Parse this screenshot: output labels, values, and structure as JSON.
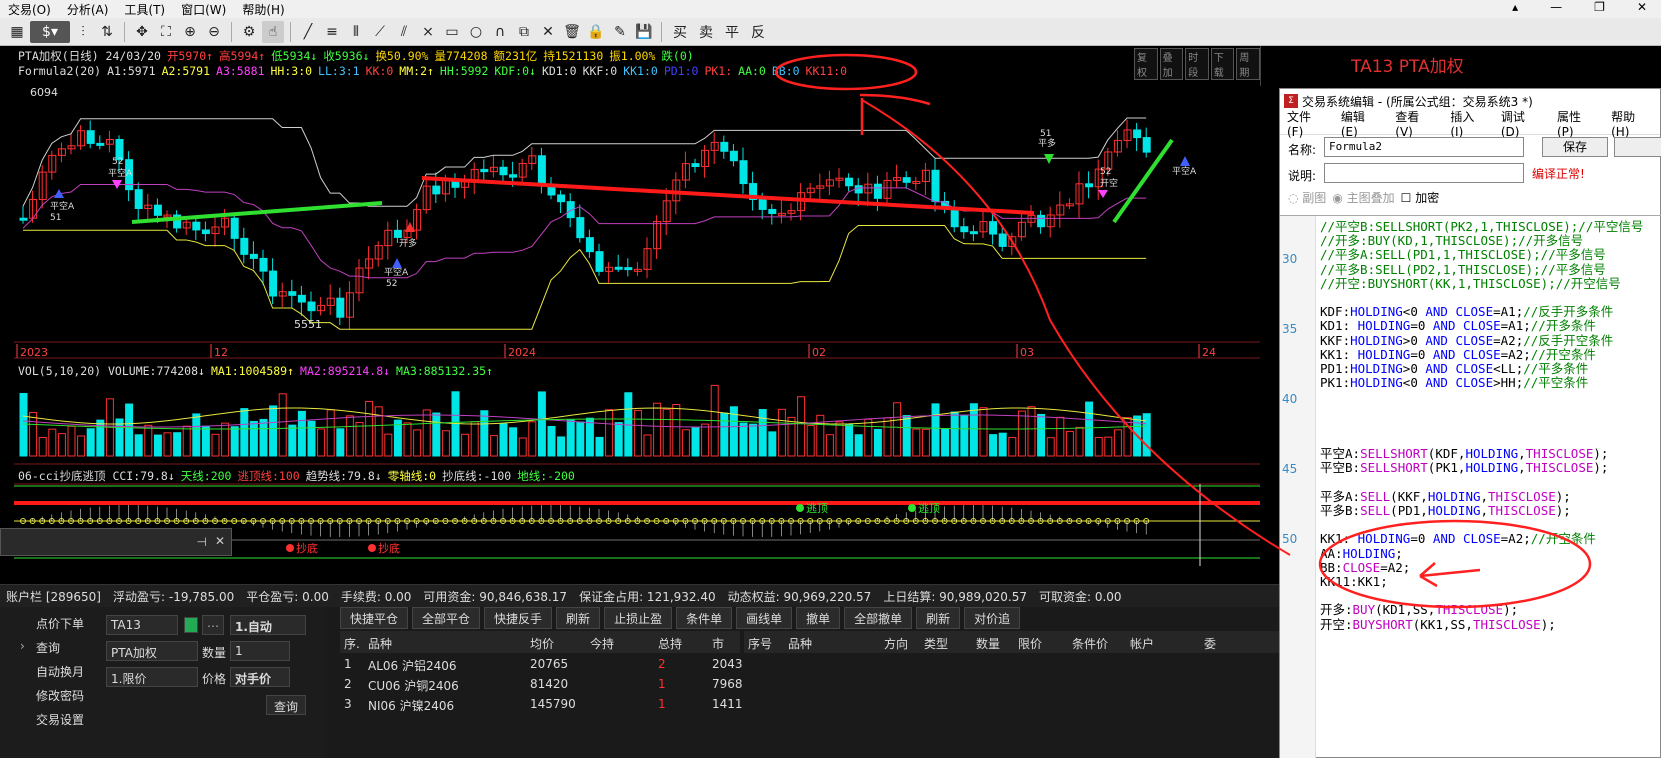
{
  "menu": [
    "交易(O)",
    "分析(A)",
    "工具(T)",
    "窗口(W)",
    "帮助(H)"
  ],
  "window_controls": [
    "▴",
    "—",
    "❐",
    "✕"
  ],
  "toolbar": {
    "dollar": "$",
    "trade_labels": [
      "买",
      "卖",
      "平",
      "反"
    ]
  },
  "chart": {
    "title_line": [
      {
        "text": "PTA加权(日线) 24/03/20",
        "color": "#dddddd"
      },
      {
        "text": "开5970↑",
        "color": "#ff4040"
      },
      {
        "text": "高5994↑",
        "color": "#ff4040"
      },
      {
        "text": "低5934↓",
        "color": "#40ff40"
      },
      {
        "text": "收5936↓",
        "color": "#40ff40"
      },
      {
        "text": "换50.90%",
        "color": "#ffd700"
      },
      {
        "text": "量774208",
        "color": "#ffd700"
      },
      {
        "text": "额231亿",
        "color": "#ffd700"
      },
      {
        "text": "持1521130",
        "color": "#ffd700"
      },
      {
        "text": "振1.00%",
        "color": "#ffd700"
      },
      {
        "text": "跌(0)",
        "color": "#40ff40"
      }
    ],
    "formula_line": [
      {
        "text": "Formula2(20)",
        "color": "#dddddd"
      },
      {
        "text": "A1:5971",
        "color": "#dddddd"
      },
      {
        "text": "A2:5791",
        "color": "#ffff40"
      },
      {
        "text": "A3:5881",
        "color": "#ff40ff"
      },
      {
        "text": "HH:3:0",
        "color": "#ffff40"
      },
      {
        "text": "LL:3:1",
        "color": "#40c0ff"
      },
      {
        "text": "KK:0",
        "color": "#ff4040"
      },
      {
        "text": "MM:2↑",
        "color": "#ffff40"
      },
      {
        "text": "HH:5992",
        "color": "#40ff40"
      },
      {
        "text": "KDF:0↓",
        "color": "#40ff40"
      },
      {
        "text": "KD1:0",
        "color": "#dddddd"
      },
      {
        "text": "KKF:0",
        "color": "#dddddd"
      },
      {
        "text": "KK1:0",
        "color": "#40c0ff"
      },
      {
        "text": "PD1:0",
        "color": "#4040ff"
      },
      {
        "text": "PK1:",
        "color": "#ff4040"
      },
      {
        "text": "AA:0",
        "color": "#40ff40"
      },
      {
        "text": "BB:0",
        "color": "#40c0ff"
      },
      {
        "text": "KK11:0",
        "color": "#ff4040"
      }
    ],
    "right_buttons": [
      "复权",
      "叠加",
      "时段",
      "下载",
      "周期"
    ],
    "price_labels": {
      "high": "6094",
      "low": "5551"
    },
    "date_labels": [
      "2023",
      "12",
      "2024",
      "02",
      "03",
      "24"
    ],
    "signal_labels": {
      "kong_a": "平空A",
      "kai_duo": "开多",
      "kai_kong": "开空",
      "ping_duo": "平多",
      "n51": "51",
      "n52": "52"
    },
    "vol_line": [
      {
        "text": "VOL(5,10,20) VOLUME:774208↓",
        "color": "#dddddd"
      },
      {
        "text": "MA1:1004589↑",
        "color": "#ffff40"
      },
      {
        "text": "MA2:895214.8↓",
        "color": "#ff40ff"
      },
      {
        "text": "MA3:885132.35↑",
        "color": "#40ff40"
      }
    ],
    "cci_line": [
      {
        "text": "06-cci抄底逃顶 CCI:79.8↓",
        "color": "#dddddd"
      },
      {
        "text": "天线:200",
        "color": "#40ff40"
      },
      {
        "text": "逃顶线:100",
        "color": "#ff4040"
      },
      {
        "text": "趋势线:79.8↓",
        "color": "#dddddd"
      },
      {
        "text": "零轴线:0",
        "color": "#ffff40"
      },
      {
        "text": "抄底线:-100",
        "color": "#dddddd"
      },
      {
        "text": "地线:-200",
        "color": "#40ff40"
      }
    ],
    "cci_labels": {
      "escape": "逃顶",
      "bottom": "抄底"
    }
  },
  "right_panel": {
    "title": "TA13  PTA加权"
  },
  "editor": {
    "title": "交易系统编辑 - (所属公式组：交易系统3 *)",
    "menu": [
      "文件(F)",
      "编辑(E)",
      "查看(V)",
      "插入(I)",
      "调试(D)",
      "属性(P)",
      "帮助(H)"
    ],
    "name_label": "名称:",
    "name_value": "Formula2",
    "save_button": "保存",
    "desc_label": "说明:",
    "compile_status": "编译正常!",
    "options": [
      "副图",
      "主图叠加",
      "加密"
    ],
    "line_numbers": [
      "30",
      "35",
      "40",
      "45",
      "50"
    ],
    "code": [
      [
        {
          "t": "//平空B:SELLSHORT(PK2,1,THISCLOSE);//平空信号",
          "c": "c"
        }
      ],
      [
        {
          "t": "//开多:BUY(KD,1,THISCLOSE);//开多信号",
          "c": "c"
        }
      ],
      [
        {
          "t": "//平多A:SELL(PD1,1,THISCLOSE);//平多信号",
          "c": "c"
        }
      ],
      [
        {
          "t": "//平多B:SELL(PD2,1,THISCLOSE);//平多信号",
          "c": "c"
        }
      ],
      [
        {
          "t": "//开空:BUYSHORT(KK,1,THISCLOSE);//开空信号",
          "c": "c"
        }
      ],
      [],
      [
        {
          "t": "KDF:",
          "c": "p"
        },
        {
          "t": "HOLDING",
          "c": "k"
        },
        {
          "t": "<0 ",
          "c": "p"
        },
        {
          "t": "AND",
          "c": "k"
        },
        {
          "t": " ",
          "c": "p"
        },
        {
          "t": "CLOSE",
          "c": "k"
        },
        {
          "t": "=A1;",
          "c": "p"
        },
        {
          "t": "//反手开多条件",
          "c": "c"
        }
      ],
      [
        {
          "t": "KD1: ",
          "c": "p"
        },
        {
          "t": "HOLDING",
          "c": "k"
        },
        {
          "t": "=0 ",
          "c": "p"
        },
        {
          "t": "AND",
          "c": "k"
        },
        {
          "t": " ",
          "c": "p"
        },
        {
          "t": "CLOSE",
          "c": "k"
        },
        {
          "t": "=A1;",
          "c": "p"
        },
        {
          "t": "//开多条件",
          "c": "c"
        }
      ],
      [
        {
          "t": "KKF:",
          "c": "p"
        },
        {
          "t": "HOLDING",
          "c": "k"
        },
        {
          "t": ">0 ",
          "c": "p"
        },
        {
          "t": "AND",
          "c": "k"
        },
        {
          "t": " ",
          "c": "p"
        },
        {
          "t": "CLOSE",
          "c": "k"
        },
        {
          "t": "=A2;",
          "c": "p"
        },
        {
          "t": "//反手开空条件",
          "c": "c"
        }
      ],
      [
        {
          "t": "KK1: ",
          "c": "p"
        },
        {
          "t": "HOLDING",
          "c": "k"
        },
        {
          "t": "=0 ",
          "c": "p"
        },
        {
          "t": "AND",
          "c": "k"
        },
        {
          "t": " ",
          "c": "p"
        },
        {
          "t": "CLOSE",
          "c": "k"
        },
        {
          "t": "=A2;",
          "c": "p"
        },
        {
          "t": "//开空条件",
          "c": "c"
        }
      ],
      [
        {
          "t": "PD1:",
          "c": "p"
        },
        {
          "t": "HOLDING",
          "c": "k"
        },
        {
          "t": ">0 ",
          "c": "p"
        },
        {
          "t": "AND",
          "c": "k"
        },
        {
          "t": " ",
          "c": "p"
        },
        {
          "t": "CLOSE",
          "c": "k"
        },
        {
          "t": "<LL;",
          "c": "p"
        },
        {
          "t": "//平多条件",
          "c": "c"
        }
      ],
      [
        {
          "t": "PK1:",
          "c": "p"
        },
        {
          "t": "HOLDING",
          "c": "k"
        },
        {
          "t": "<0 ",
          "c": "p"
        },
        {
          "t": "AND",
          "c": "k"
        },
        {
          "t": " ",
          "c": "p"
        },
        {
          "t": "CLOSE",
          "c": "k"
        },
        {
          "t": ">HH;",
          "c": "p"
        },
        {
          "t": "//平空条件",
          "c": "c"
        }
      ],
      [],
      [],
      [],
      [],
      [
        {
          "t": "平空A:",
          "c": "p"
        },
        {
          "t": "SELLSHORT",
          "c": "f"
        },
        {
          "t": "(KDF,",
          "c": "p"
        },
        {
          "t": "HOLDING",
          "c": "k"
        },
        {
          "t": ",",
          "c": "p"
        },
        {
          "t": "THISCLOSE",
          "c": "f"
        },
        {
          "t": ");",
          "c": "p"
        }
      ],
      [
        {
          "t": "平空B:",
          "c": "p"
        },
        {
          "t": "SELLSHORT",
          "c": "f"
        },
        {
          "t": "(PK1,",
          "c": "p"
        },
        {
          "t": "HOLDING",
          "c": "k"
        },
        {
          "t": ",",
          "c": "p"
        },
        {
          "t": "THISCLOSE",
          "c": "f"
        },
        {
          "t": ");",
          "c": "p"
        }
      ],
      [],
      [
        {
          "t": "平多A:",
          "c": "p"
        },
        {
          "t": "SELL",
          "c": "f"
        },
        {
          "t": "(KKF,",
          "c": "p"
        },
        {
          "t": "HOLDING",
          "c": "k"
        },
        {
          "t": ",",
          "c": "p"
        },
        {
          "t": "THISCLOSE",
          "c": "f"
        },
        {
          "t": ");",
          "c": "p"
        }
      ],
      [
        {
          "t": "平多B:",
          "c": "p"
        },
        {
          "t": "SELL",
          "c": "f"
        },
        {
          "t": "(PD1,",
          "c": "p"
        },
        {
          "t": "HOLDING",
          "c": "k"
        },
        {
          "t": ",",
          "c": "p"
        },
        {
          "t": "THISCLOSE",
          "c": "f"
        },
        {
          "t": ");",
          "c": "p"
        }
      ],
      [],
      [
        {
          "t": "KK1: ",
          "c": "p"
        },
        {
          "t": "HOLDING",
          "c": "k"
        },
        {
          "t": "=0 ",
          "c": "p"
        },
        {
          "t": "AND",
          "c": "k"
        },
        {
          "t": " ",
          "c": "p"
        },
        {
          "t": "CLOSE",
          "c": "k"
        },
        {
          "t": "=A2;",
          "c": "p"
        },
        {
          "t": "//开空条件",
          "c": "c"
        }
      ],
      [
        {
          "t": "AA:",
          "c": "p"
        },
        {
          "t": "HOLDING",
          "c": "k"
        },
        {
          "t": ";",
          "c": "p"
        }
      ],
      [
        {
          "t": "BB:",
          "c": "p"
        },
        {
          "t": "CLOSE",
          "c": "f"
        },
        {
          "t": "=A2;",
          "c": "p"
        }
      ],
      [
        {
          "t": "KK11:KK1;",
          "c": "p"
        }
      ],
      [],
      [
        {
          "t": "开多:",
          "c": "p"
        },
        {
          "t": "BUY",
          "c": "f"
        },
        {
          "t": "(KD1,SS,",
          "c": "p"
        },
        {
          "t": "THISCLOSE",
          "c": "f"
        },
        {
          "t": ");",
          "c": "p"
        }
      ],
      [
        {
          "t": "开空:",
          "c": "p"
        },
        {
          "t": "BUYSHORT",
          "c": "f"
        },
        {
          "t": "(KK1,SS,",
          "c": "p"
        },
        {
          "t": "THISCLOSE",
          "c": "f"
        },
        {
          "t": ");",
          "c": "p"
        }
      ]
    ]
  },
  "account": {
    "bar": [
      "账户栏 [289650]",
      "浮动盈亏: -19,785.00",
      "平仓盈亏: 0.00",
      "手续费: 0.00",
      "可用资金: 90,846,638.17",
      "保证金占用: 121,932.40",
      "动态权益: 90,969,220.57",
      "上日结算: 90,989,020.57",
      "可取资金: 0.00"
    ],
    "nav": [
      "点价下单",
      "查询",
      "自动换月",
      "修改密码",
      "交易设置"
    ],
    "order": {
      "contract": "TA13",
      "contract_name": "PTA加权",
      "mode": "1.自动",
      "qty_label": "数量",
      "qty": "1",
      "price_type": "1.限价",
      "price_label": "价格",
      "price": "对手价",
      "query_button": "查询"
    },
    "action_buttons": [
      "快捷平仓",
      "全部平仓",
      "快捷反手",
      "刷新",
      "止损止盈",
      "条件单",
      "画线单",
      "撤单",
      "全部撤单",
      "刷新",
      "对价追"
    ],
    "positions_header": [
      "序.",
      "品种",
      "均价",
      "今持",
      "总持",
      "市"
    ],
    "positions": [
      [
        "1",
        "AL06 沪铝2406",
        "20765",
        "",
        "2",
        "2043"
      ],
      [
        "2",
        "CU06 沪铜2406",
        "81420",
        "",
        "1",
        "7968"
      ],
      [
        "3",
        "NI06 沪镍2406",
        "145790",
        "",
        "1",
        "1411"
      ]
    ],
    "orders_header": [
      "序号",
      "品种",
      "方向",
      "类型",
      "数量",
      "限价",
      "条件价",
      "帐户",
      "委"
    ]
  },
  "colors": {
    "up": "#ff3030",
    "down": "#00e5e5",
    "annotation": "#ff2020"
  }
}
